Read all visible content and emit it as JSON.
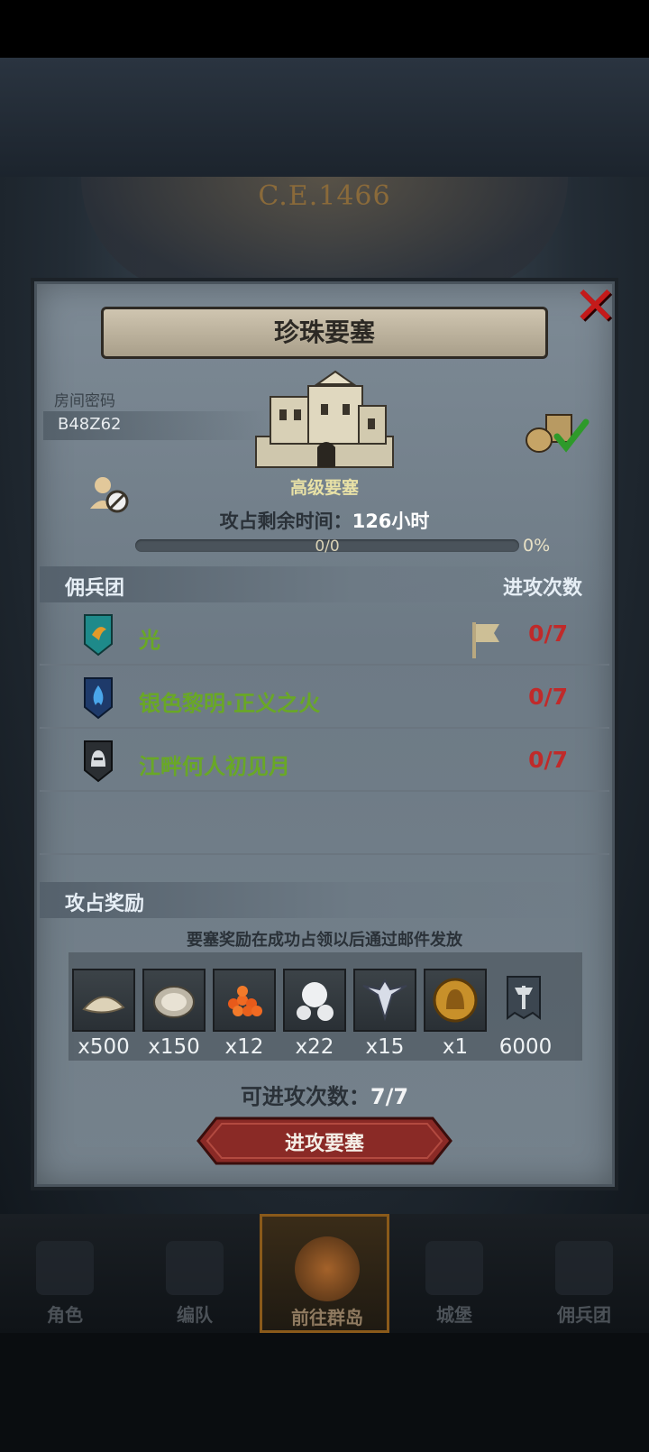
{
  "background": {
    "era": "C.E.1466"
  },
  "dialog": {
    "title": "珍珠要塞",
    "room_label": "房间密码",
    "room_code": "B48Z62",
    "fortress_type": "高级要塞",
    "timer_label": "攻占剩余时间：",
    "timer_value": "126小时",
    "progress_text": "0/0",
    "progress_percent": "0%",
    "progress_fraction": 0
  },
  "mercenaries": {
    "header": "佣兵团",
    "header_right": "进攻次数",
    "rows": [
      {
        "name": "光",
        "count": "0/7",
        "shield": "teal-bird-shield-icon",
        "flag": true
      },
      {
        "name": "银色黎明·正义之火",
        "count": "0/7",
        "shield": "blue-flame-shield-icon",
        "flag": false
      },
      {
        "name": "江畔何人初见月",
        "count": "0/7",
        "shield": "knight-helm-shield-icon",
        "flag": false
      }
    ]
  },
  "rewards": {
    "header": "攻占奖励",
    "note": "要塞奖励在成功占领以后通过邮件发放",
    "items": [
      {
        "icon": "salt-pile-icon",
        "qty": "x500"
      },
      {
        "icon": "oyster-shell-icon",
        "qty": "x150"
      },
      {
        "icon": "fish-roe-icon",
        "qty": "x12"
      },
      {
        "icon": "pearl-icon",
        "qty": "x22"
      },
      {
        "icon": "winged-emblem-icon",
        "qty": "x15"
      },
      {
        "icon": "gold-helmet-coin-icon",
        "qty": "x1"
      },
      {
        "icon": "banner-icon",
        "qty": "6000"
      }
    ]
  },
  "attacks": {
    "label": "可进攻次数：",
    "value": "7/7"
  },
  "attack_button": "进攻要塞",
  "nav": [
    {
      "label": "角色"
    },
    {
      "label": "编队"
    },
    {
      "label": "前往群岛"
    },
    {
      "label": "城堡"
    },
    {
      "label": "佣兵团"
    }
  ],
  "colors": {
    "panel": "#75828c",
    "merc_name": "#69a826",
    "count": "#c02a2a",
    "button": "#8a2a26"
  }
}
